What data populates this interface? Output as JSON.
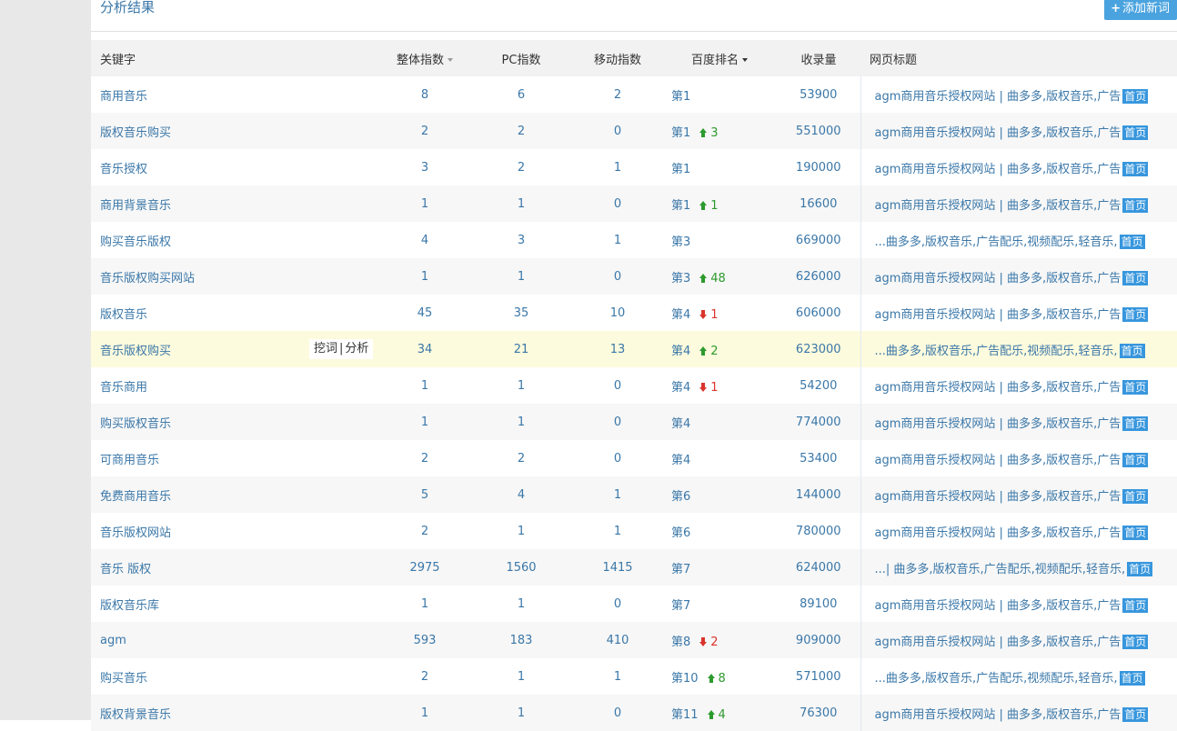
{
  "panel": {
    "title": "分析结果",
    "add_button_label": "添加新词",
    "add_button_icon": "plus-icon"
  },
  "columns": {
    "keyword": "关键字",
    "total_index": "整体指数",
    "pc_index": "PC指数",
    "mobile_index": "移动指数",
    "baidu_rank": "百度排名",
    "indexed_count": "收录量",
    "page_title": "网页标题"
  },
  "row_actions": {
    "dig": "挖词",
    "separator": "|",
    "analyze": "分析"
  },
  "home_badge": "首页",
  "colors": {
    "accent": "#3a77a8",
    "button": "#4aa3df",
    "rank_up": "#2d9a2d",
    "rank_down": "#d9342b",
    "highlight_row": "#fdfbdd"
  },
  "rows": [
    {
      "keyword": "商用音乐",
      "total": "8",
      "pc": "6",
      "mobile": "2",
      "rank": "第1",
      "change": "",
      "dir": "",
      "indexed": "53900",
      "title": "agm商用音乐授权网站 | 曲多多,版权音乐,广告"
    },
    {
      "keyword": "版权音乐购买",
      "total": "2",
      "pc": "2",
      "mobile": "0",
      "rank": "第1",
      "change": "3",
      "dir": "up",
      "indexed": "551000",
      "title": "agm商用音乐授权网站 | 曲多多,版权音乐,广告"
    },
    {
      "keyword": "音乐授权",
      "total": "3",
      "pc": "2",
      "mobile": "1",
      "rank": "第1",
      "change": "",
      "dir": "",
      "indexed": "190000",
      "title": "agm商用音乐授权网站 | 曲多多,版权音乐,广告"
    },
    {
      "keyword": "商用背景音乐",
      "total": "1",
      "pc": "1",
      "mobile": "0",
      "rank": "第1",
      "change": "1",
      "dir": "up",
      "indexed": "16600",
      "title": "agm商用音乐授权网站 | 曲多多,版权音乐,广告"
    },
    {
      "keyword": "购买音乐版权",
      "total": "4",
      "pc": "3",
      "mobile": "1",
      "rank": "第3",
      "change": "",
      "dir": "",
      "indexed": "669000",
      "title": "...曲多多,版权音乐,广告配乐,视频配乐,轻音乐,"
    },
    {
      "keyword": "音乐版权购买网站",
      "total": "1",
      "pc": "1",
      "mobile": "0",
      "rank": "第3",
      "change": "48",
      "dir": "up",
      "indexed": "626000",
      "title": "agm商用音乐授权网站 | 曲多多,版权音乐,广告"
    },
    {
      "keyword": "版权音乐",
      "total": "45",
      "pc": "35",
      "mobile": "10",
      "rank": "第4",
      "change": "1",
      "dir": "down",
      "indexed": "606000",
      "title": "agm商用音乐授权网站 | 曲多多,版权音乐,广告"
    },
    {
      "keyword": "音乐版权购买",
      "total": "34",
      "pc": "21",
      "mobile": "13",
      "rank": "第4",
      "change": "2",
      "dir": "up",
      "indexed": "623000",
      "title": "...曲多多,版权音乐,广告配乐,视频配乐,轻音乐,"
    },
    {
      "keyword": "音乐商用",
      "total": "1",
      "pc": "1",
      "mobile": "0",
      "rank": "第4",
      "change": "1",
      "dir": "down",
      "indexed": "54200",
      "title": "agm商用音乐授权网站 | 曲多多,版权音乐,广告"
    },
    {
      "keyword": "购买版权音乐",
      "total": "1",
      "pc": "1",
      "mobile": "0",
      "rank": "第4",
      "change": "",
      "dir": "",
      "indexed": "774000",
      "title": "agm商用音乐授权网站 | 曲多多,版权音乐,广告"
    },
    {
      "keyword": "可商用音乐",
      "total": "2",
      "pc": "2",
      "mobile": "0",
      "rank": "第4",
      "change": "",
      "dir": "",
      "indexed": "53400",
      "title": "agm商用音乐授权网站 | 曲多多,版权音乐,广告"
    },
    {
      "keyword": "免费商用音乐",
      "total": "5",
      "pc": "4",
      "mobile": "1",
      "rank": "第6",
      "change": "",
      "dir": "",
      "indexed": "144000",
      "title": "agm商用音乐授权网站 | 曲多多,版权音乐,广告"
    },
    {
      "keyword": "音乐版权网站",
      "total": "2",
      "pc": "1",
      "mobile": "1",
      "rank": "第6",
      "change": "",
      "dir": "",
      "indexed": "780000",
      "title": "agm商用音乐授权网站 | 曲多多,版权音乐,广告"
    },
    {
      "keyword": "音乐 版权",
      "total": "2975",
      "pc": "1560",
      "mobile": "1415",
      "rank": "第7",
      "change": "",
      "dir": "",
      "indexed": "624000",
      "title": "...| 曲多多,版权音乐,广告配乐,视频配乐,轻音乐,"
    },
    {
      "keyword": "版权音乐库",
      "total": "1",
      "pc": "1",
      "mobile": "0",
      "rank": "第7",
      "change": "",
      "dir": "",
      "indexed": "89100",
      "title": "agm商用音乐授权网站 | 曲多多,版权音乐,广告"
    },
    {
      "keyword": "agm",
      "total": "593",
      "pc": "183",
      "mobile": "410",
      "rank": "第8",
      "change": "2",
      "dir": "down",
      "indexed": "909000",
      "title": "agm商用音乐授权网站 | 曲多多,版权音乐,广告"
    },
    {
      "keyword": "购买音乐",
      "total": "2",
      "pc": "1",
      "mobile": "1",
      "rank": "第10",
      "change": "8",
      "dir": "up",
      "indexed": "571000",
      "title": "...曲多多,版权音乐,广告配乐,视频配乐,轻音乐,"
    },
    {
      "keyword": "版权背景音乐",
      "total": "1",
      "pc": "1",
      "mobile": "0",
      "rank": "第11",
      "change": "4",
      "dir": "up",
      "indexed": "76300",
      "title": "agm商用音乐授权网站 | 曲多多,版权音乐,广告"
    }
  ],
  "highlighted_row_index": 7
}
